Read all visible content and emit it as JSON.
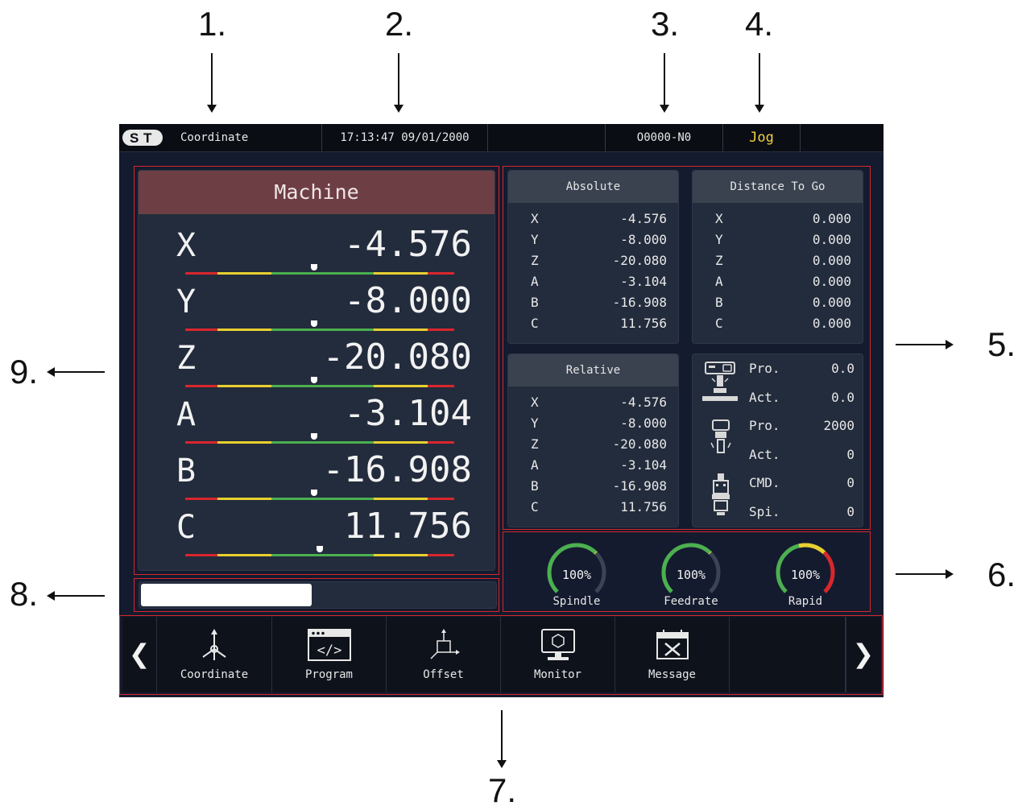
{
  "callouts": [
    "1.",
    "2.",
    "3.",
    "4.",
    "5.",
    "6.",
    "7.",
    "8.",
    "9."
  ],
  "topbar": {
    "page": "Coordinate",
    "datetime": "17:13:47 09/01/2000",
    "program": "O0000-N0",
    "mode": "Jog",
    "mode_color": "#f0d040"
  },
  "machine": {
    "title": "Machine",
    "axes": [
      {
        "axis": "X",
        "value": "-4.576",
        "indicator": 0.48
      },
      {
        "axis": "Y",
        "value": "-8.000",
        "indicator": 0.48
      },
      {
        "axis": "Z",
        "value": "-20.080",
        "indicator": 0.48
      },
      {
        "axis": "A",
        "value": "-3.104",
        "indicator": 0.48
      },
      {
        "axis": "B",
        "value": "-16.908",
        "indicator": 0.48
      },
      {
        "axis": "C",
        "value": "11.756",
        "indicator": 0.5
      }
    ]
  },
  "absolute": {
    "title": "Absolute",
    "rows": [
      {
        "axis": "X",
        "value": "-4.576"
      },
      {
        "axis": "Y",
        "value": "-8.000"
      },
      {
        "axis": "Z",
        "value": "-20.080"
      },
      {
        "axis": "A",
        "value": "-3.104"
      },
      {
        "axis": "B",
        "value": "-16.908"
      },
      {
        "axis": "C",
        "value": "11.756"
      }
    ]
  },
  "distance_to_go": {
    "title": "Distance To Go",
    "rows": [
      {
        "axis": "X",
        "value": "0.000"
      },
      {
        "axis": "Y",
        "value": "0.000"
      },
      {
        "axis": "Z",
        "value": "0.000"
      },
      {
        "axis": "A",
        "value": "0.000"
      },
      {
        "axis": "B",
        "value": "0.000"
      },
      {
        "axis": "C",
        "value": "0.000"
      }
    ]
  },
  "relative": {
    "title": "Relative",
    "rows": [
      {
        "axis": "X",
        "value": "-4.576"
      },
      {
        "axis": "Y",
        "value": "-8.000"
      },
      {
        "axis": "Z",
        "value": "-20.080"
      },
      {
        "axis": "A",
        "value": "-3.104"
      },
      {
        "axis": "B",
        "value": "-16.908"
      },
      {
        "axis": "C",
        "value": "11.756"
      }
    ]
  },
  "spindle_info": {
    "rows": [
      {
        "label": "Pro.",
        "value": "0.0"
      },
      {
        "label": "Act.",
        "value": "0.0"
      },
      {
        "label": "Pro.",
        "value": "2000"
      },
      {
        "label": "Act.",
        "value": "0"
      },
      {
        "label": "CMD.",
        "value": "0"
      },
      {
        "label": "Spi.",
        "value": "0"
      }
    ],
    "icons": [
      "feed-machine-icon",
      "spindle-motor-icon",
      "spindle-tool-icon"
    ]
  },
  "gauges": [
    {
      "label": "Spindle",
      "value": "100%",
      "percent": 100
    },
    {
      "label": "Feedrate",
      "value": "100%",
      "percent": 100
    },
    {
      "label": "Rapid",
      "value": "100%",
      "percent": 100
    }
  ],
  "progress": {
    "fraction": 0.48
  },
  "nav": {
    "prev_icon": "chevron-left-icon",
    "next_icon": "chevron-right-icon",
    "items": [
      {
        "label": "Coordinate",
        "icon": "coordinate-axes-icon"
      },
      {
        "label": "Program",
        "icon": "code-window-icon"
      },
      {
        "label": "Offset",
        "icon": "offset-axes-icon"
      },
      {
        "label": "Monitor",
        "icon": "monitor-icon"
      },
      {
        "label": "Message",
        "icon": "message-tools-icon"
      },
      {
        "label": "",
        "icon": ""
      }
    ]
  },
  "colors": {
    "highlight_border": "#d8262d",
    "machine_header": "#6e3e45",
    "scale_red": "#d8262d",
    "scale_yellow": "#e8d030",
    "scale_green": "#4caf50"
  }
}
